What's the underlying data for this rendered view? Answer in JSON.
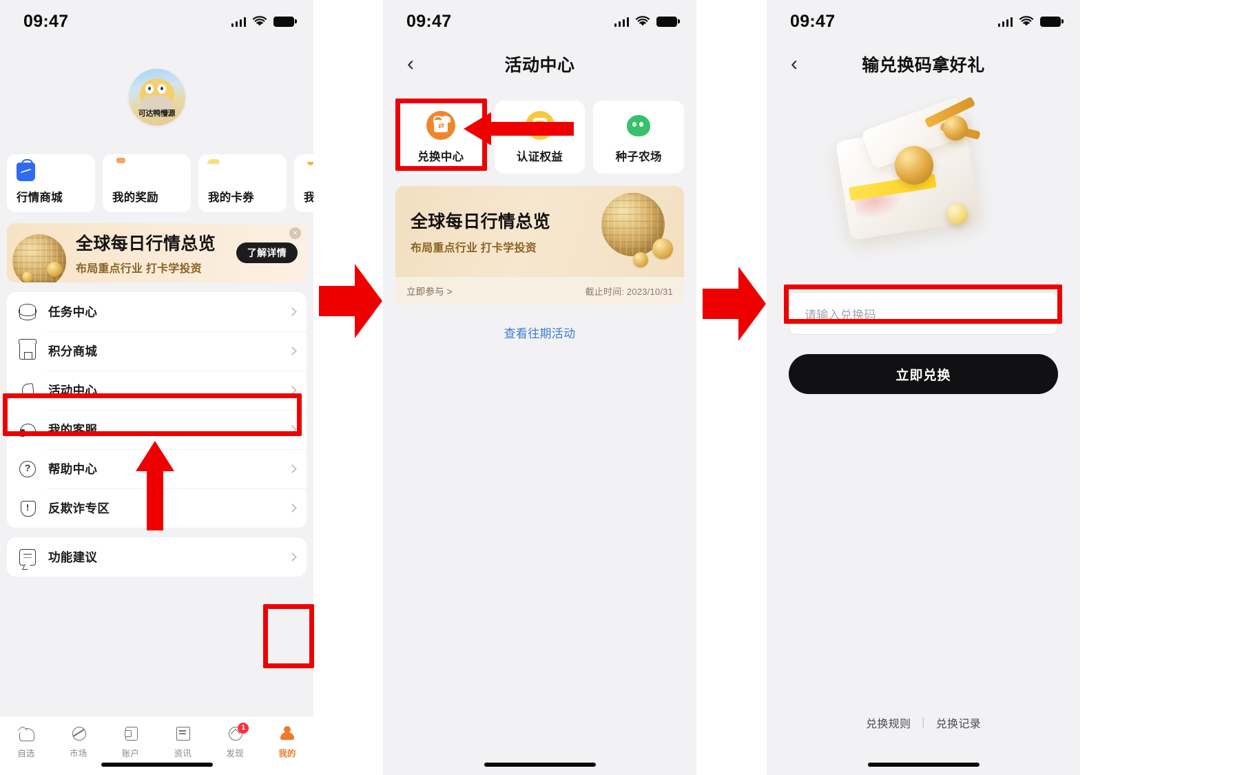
{
  "status_bar": {
    "time": "09:47"
  },
  "panel1": {
    "profile": {
      "nickname": "可达鸭懵源"
    },
    "quick_cards": [
      {
        "label": "行情商城",
        "icon": "shopping-bag-icon"
      },
      {
        "label": "我的奖励",
        "icon": "money-bag-icon"
      },
      {
        "label": "我的卡券",
        "icon": "coupon-card-icon"
      },
      {
        "label": "我的提醒",
        "icon": "bell-icon"
      }
    ],
    "promo": {
      "title": "全球每日行情总览",
      "subtitle": "布局重点行业 打卡学投资",
      "button": "了解详情",
      "close": "×"
    },
    "menu_group_1": [
      {
        "label": "任务中心",
        "icon": "database-icon"
      },
      {
        "label": "积分商城",
        "icon": "store-icon"
      },
      {
        "label": "活动中心",
        "icon": "flame-icon"
      },
      {
        "label": "我的客服",
        "icon": "headset-icon"
      },
      {
        "label": "帮助中心",
        "icon": "question-circle-icon"
      },
      {
        "label": "反欺诈专区",
        "icon": "shield-alert-icon"
      }
    ],
    "menu_group_2": [
      {
        "label": "功能建议",
        "icon": "feedback-chat-icon"
      }
    ],
    "tabs": [
      {
        "label": "自选",
        "icon": "heart-icon",
        "active": false,
        "badge": ""
      },
      {
        "label": "市场",
        "icon": "market-icon",
        "active": false,
        "badge": ""
      },
      {
        "label": "账户",
        "icon": "account-icon",
        "active": false,
        "badge": ""
      },
      {
        "label": "资讯",
        "icon": "news-icon",
        "active": false,
        "badge": ""
      },
      {
        "label": "发现",
        "icon": "discover-icon",
        "active": false,
        "badge": "1"
      },
      {
        "label": "我的",
        "icon": "profile-icon",
        "active": true,
        "badge": ""
      }
    ]
  },
  "panel2": {
    "nav": {
      "back": "‹",
      "title": "活动中心"
    },
    "entries": [
      {
        "label": "兑换中心",
        "icon": "gift-box-icon"
      },
      {
        "label": "认证权益",
        "icon": "verified-shield-icon"
      },
      {
        "label": "种子农场",
        "icon": "seed-farm-icon"
      }
    ],
    "activity_card": {
      "title": "全球每日行情总览",
      "subtitle": "布局重点行业 打卡学投资",
      "join_label": "立即参与 >",
      "deadline": "截止时间: 2023/10/31"
    },
    "past_link": "查看往期活动"
  },
  "panel3": {
    "nav": {
      "back": "‹",
      "title": "输兑换码拿好礼"
    },
    "code_input_placeholder": "请输入兑换码",
    "redeem_button": "立即兑换",
    "footer": {
      "rules": "兑换规则",
      "separator": "|",
      "records": "兑换记录"
    }
  },
  "annotations": {
    "color": "#EF0000",
    "highlight_1": "活动中心",
    "highlight_2": "我的",
    "highlight_3": "兑换中心",
    "highlight_4": "请输入兑换码"
  }
}
